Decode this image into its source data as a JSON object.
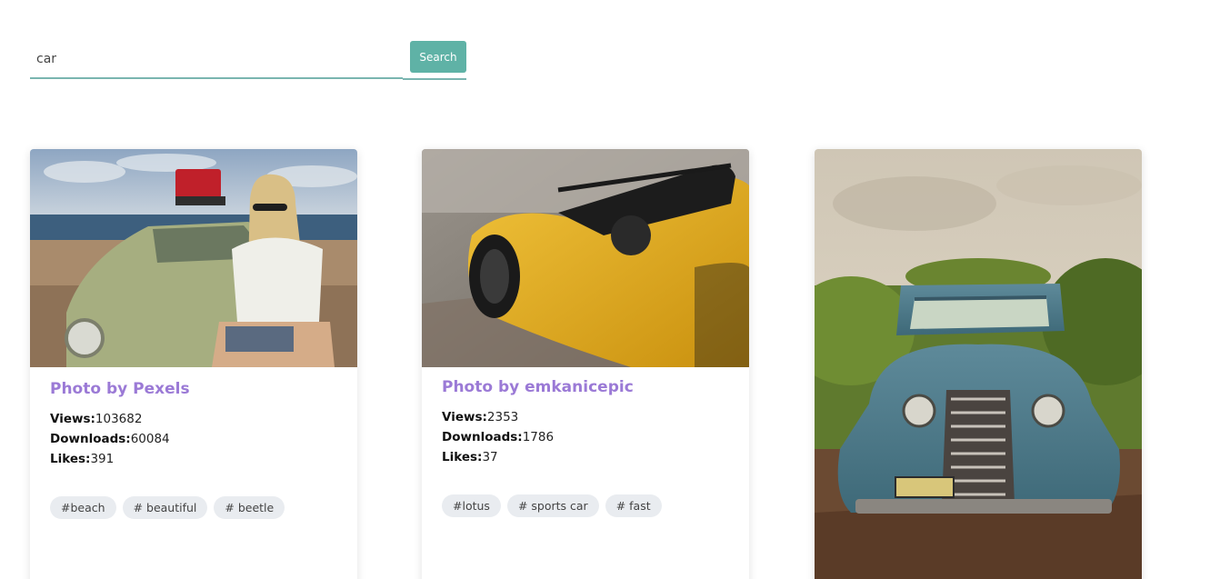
{
  "search": {
    "value": "car",
    "button_label": "Search"
  },
  "cards": [
    {
      "title": "Photo by Pexels",
      "views_label": "Views:",
      "views": "103682",
      "downloads_label": "Downloads:",
      "downloads": "60084",
      "likes_label": "Likes:",
      "likes": "391",
      "tags": [
        "#beach",
        "# beautiful",
        "# beetle"
      ],
      "image_subject": "woman sitting on green vintage beetle car at beach"
    },
    {
      "title": "Photo by emkanicepic",
      "views_label": "Views:",
      "views": "2353",
      "downloads_label": "Downloads:",
      "downloads": "1786",
      "likes_label": "Likes:",
      "likes": "37",
      "tags": [
        "#lotus",
        "# sports car",
        "# fast"
      ],
      "image_subject": "yellow convertible sports car"
    },
    {
      "image_subject": "old blue pickup truck in vineyard"
    }
  ],
  "colors": {
    "accent": "#5fb2a6",
    "title": "#9b7ad6",
    "tag_bg": "#e9ecf0"
  }
}
